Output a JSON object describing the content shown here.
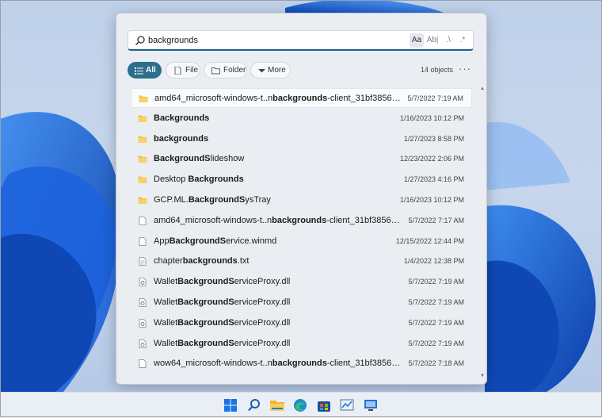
{
  "search": {
    "query": "backgrounds",
    "options": [
      "Aa",
      "Ab|",
      ".\\",
      ".*"
    ]
  },
  "filters": [
    {
      "label": "All",
      "icon": "list-icon",
      "active": true
    },
    {
      "label": "File",
      "icon": "file-icon",
      "active": false
    },
    {
      "label": "Folder",
      "icon": "folder-icon",
      "active": false
    },
    {
      "label": "More",
      "icon": "chevron-down-icon",
      "active": false
    }
  ],
  "result_count": "14 objects",
  "more_menu": "···",
  "results": [
    {
      "type": "folder",
      "pre": "amd64_microsoft-windows-t..n",
      "match": "backgrounds",
      "post": "-client_31bf3856ad...",
      "date": "5/7/2022 7:19 AM",
      "selected": true
    },
    {
      "type": "folder",
      "pre": "",
      "match": "Backgrounds",
      "post": "",
      "date": "1/16/2023 10:12 PM"
    },
    {
      "type": "folder",
      "pre": "",
      "match": "backgrounds",
      "post": "",
      "date": "1/27/2023 8:58 PM"
    },
    {
      "type": "folder",
      "pre": "",
      "match": "BackgroundS",
      "post": "lideshow",
      "date": "12/23/2022 2:06 PM"
    },
    {
      "type": "folder",
      "pre": "Desktop ",
      "match": "Backgrounds",
      "post": "",
      "date": "1/27/2023 4:16 PM"
    },
    {
      "type": "folder",
      "pre": "GCP.ML.",
      "match": "BackgroundS",
      "post": "ysTray",
      "date": "1/16/2023 10:12 PM"
    },
    {
      "type": "file",
      "pre": "amd64_microsoft-windows-t..n",
      "match": "backgrounds",
      "post": "-client_31bf3856ad...",
      "date": "5/7/2022 7:17 AM"
    },
    {
      "type": "file",
      "pre": "App",
      "match": "BackgroundS",
      "post": "ervice.winmd",
      "date": "12/15/2022 12:44 PM"
    },
    {
      "type": "text",
      "pre": "chapter",
      "match": "backgrounds",
      "post": ".txt",
      "date": "1/4/2022 12:38 PM"
    },
    {
      "type": "dll",
      "pre": "Wallet",
      "match": "BackgroundS",
      "post": "erviceProxy.dll",
      "date": "5/7/2022 7:19 AM"
    },
    {
      "type": "dll",
      "pre": "Wallet",
      "match": "BackgroundS",
      "post": "erviceProxy.dll",
      "date": "5/7/2022 7:19 AM"
    },
    {
      "type": "dll",
      "pre": "Wallet",
      "match": "BackgroundS",
      "post": "erviceProxy.dll",
      "date": "5/7/2022 7:19 AM"
    },
    {
      "type": "dll",
      "pre": "Wallet",
      "match": "BackgroundS",
      "post": "erviceProxy.dll",
      "date": "5/7/2022 7:19 AM"
    },
    {
      "type": "file",
      "pre": "wow64_microsoft-windows-t..n",
      "match": "backgrounds",
      "post": "-client_31bf3856ad...",
      "date": "5/7/2022 7:18 AM"
    }
  ],
  "taskbar": [
    {
      "name": "windows-start-icon"
    },
    {
      "name": "search-icon"
    },
    {
      "name": "file-explorer-icon"
    },
    {
      "name": "edge-browser-icon"
    },
    {
      "name": "store-icon"
    },
    {
      "name": "chart-app-icon"
    },
    {
      "name": "remote-desktop-icon"
    }
  ],
  "colors": {
    "accent": "#2a6f8c",
    "folder": "#f2c14e",
    "wallpaper": "#1a5fd6"
  }
}
